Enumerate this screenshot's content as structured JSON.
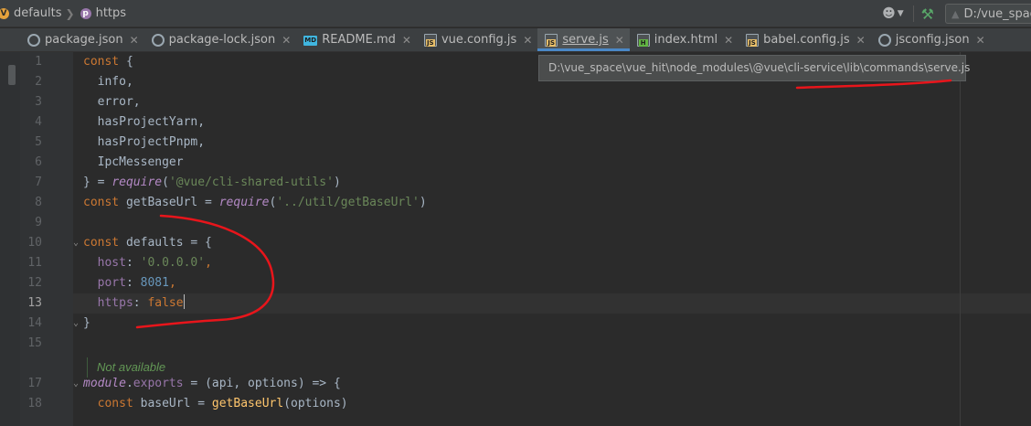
{
  "navbar": {
    "breadcrumbs": [
      {
        "label": "defaults",
        "icon": "v-badge-icon",
        "icon_letter": "V",
        "icon_color": "#e6a23c"
      },
      {
        "label": "https",
        "icon": "p-badge-icon",
        "icon_letter": "p",
        "icon_color": "#9876aa"
      }
    ],
    "run_config": "D:/vue_space"
  },
  "tabs": [
    {
      "label": "package.json",
      "icon": "gear-file-icon",
      "active": false
    },
    {
      "label": "package-lock.json",
      "icon": "gear-file-icon",
      "active": false
    },
    {
      "label": "README.md",
      "icon": "markdown-file-icon",
      "active": false
    },
    {
      "label": "vue.config.js",
      "icon": "js-file-icon",
      "active": false
    },
    {
      "label": "serve.js",
      "icon": "js-file-icon",
      "active": true
    },
    {
      "label": "index.html",
      "icon": "html-file-icon",
      "active": false
    },
    {
      "label": "babel.config.js",
      "icon": "js-file-icon",
      "active": false
    },
    {
      "label": "jsconfig.json",
      "icon": "gear-file-icon",
      "active": false
    }
  ],
  "tooltip": {
    "path": "D:\\vue_space\\vue_hit\\node_modules\\@vue\\cli-service\\lib\\commands\\serve.js"
  },
  "editor": {
    "current_line": 13,
    "lines": [
      {
        "n": "1",
        "segs": [
          [
            "kw",
            "const "
          ],
          [
            "id",
            "{"
          ]
        ]
      },
      {
        "n": "2",
        "segs": [
          [
            "id",
            "  info,"
          ]
        ]
      },
      {
        "n": "3",
        "segs": [
          [
            "id",
            "  error,"
          ]
        ]
      },
      {
        "n": "4",
        "segs": [
          [
            "id",
            "  hasProjectYarn,"
          ]
        ]
      },
      {
        "n": "5",
        "segs": [
          [
            "id",
            "  hasProjectPnpm,"
          ]
        ]
      },
      {
        "n": "6",
        "segs": [
          [
            "id",
            "  IpcMessenger"
          ]
        ]
      },
      {
        "n": "7",
        "segs": [
          [
            "id",
            "} = "
          ],
          [
            "req",
            "require"
          ],
          [
            "id",
            "("
          ],
          [
            "str",
            "'@vue/cli-shared-utils'"
          ],
          [
            "id",
            ")"
          ]
        ]
      },
      {
        "n": "8",
        "segs": [
          [
            "kw",
            "const "
          ],
          [
            "id",
            "getBaseUrl = "
          ],
          [
            "req",
            "require"
          ],
          [
            "id",
            "("
          ],
          [
            "str",
            "'../util/getBaseUrl'"
          ],
          [
            "id",
            ")"
          ]
        ]
      },
      {
        "n": "9",
        "segs": []
      },
      {
        "n": "10",
        "segs": [
          [
            "kw",
            "const "
          ],
          [
            "id",
            "defaults = {"
          ]
        ]
      },
      {
        "n": "11",
        "segs": [
          [
            "prop",
            "  host"
          ],
          [
            "id",
            ": "
          ],
          [
            "str",
            "'0.0.0.0'"
          ],
          [
            "kw",
            ","
          ]
        ]
      },
      {
        "n": "12",
        "segs": [
          [
            "prop",
            "  port"
          ],
          [
            "id",
            ": "
          ],
          [
            "num",
            "8081"
          ],
          [
            "kw",
            ","
          ]
        ]
      },
      {
        "n": "13",
        "segs": [
          [
            "prop",
            "  https"
          ],
          [
            "id",
            ": "
          ],
          [
            "kw",
            "false"
          ]
        ]
      },
      {
        "n": "14",
        "segs": [
          [
            "id",
            "}"
          ]
        ]
      },
      {
        "n": "15",
        "segs": []
      },
      {
        "n": "",
        "segs": []
      },
      {
        "n": "17",
        "segs": [
          [
            "mod",
            "module"
          ],
          [
            "id",
            "."
          ],
          [
            "prop",
            "exports"
          ],
          [
            "id",
            " = (api, options) => {"
          ]
        ]
      },
      {
        "n": "18",
        "segs": [
          [
            "kw",
            "  const "
          ],
          [
            "id",
            "baseUrl = "
          ],
          [
            "fn",
            "getBaseUrl"
          ],
          [
            "id",
            "(options)"
          ]
        ]
      }
    ],
    "inline_hint": "Not available"
  },
  "colors": {
    "background": "#2b2b2b",
    "keyword": "#cc7832",
    "string": "#6a8759",
    "number": "#6897bb",
    "property": "#9876aa",
    "active_tab_underline": "#4a88c7",
    "annotation_stroke": "#e8151b"
  }
}
